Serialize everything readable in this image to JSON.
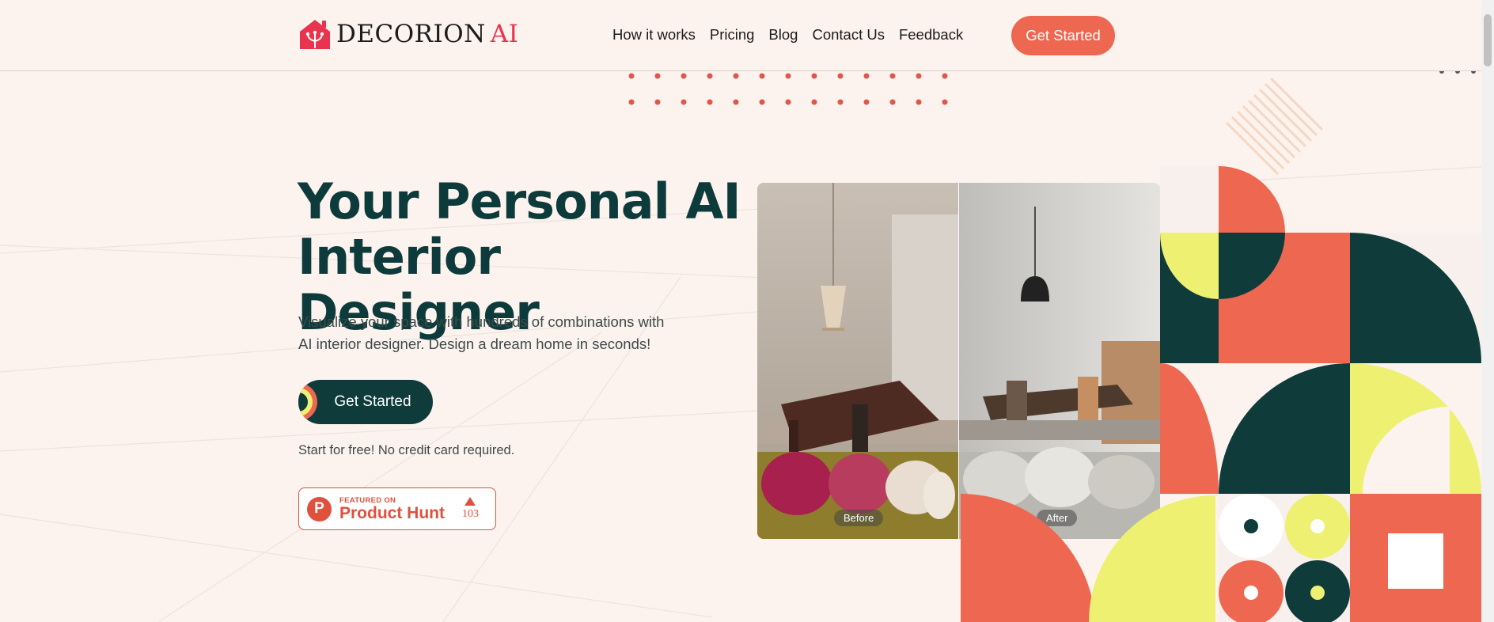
{
  "header": {
    "logo_text": "DECORION",
    "logo_ai": "AI",
    "nav": [
      "How it works",
      "Pricing",
      "Blog",
      "Contact Us",
      "Feedback"
    ],
    "cta": "Get Started"
  },
  "hero": {
    "title_line1": "Your Personal AI",
    "title_line2": "Interior Designer",
    "subtitle_line1": "Visualize your space with hundreds of combinations with",
    "subtitle_line2": "AI interior designer. Design a dream home in seconds!",
    "cta": "Get Started",
    "note": "Start for free! No credit card required."
  },
  "product_hunt": {
    "featured_on": "FEATURED ON",
    "name": "Product Hunt",
    "votes": "103",
    "logo_letter": "P"
  },
  "comparison": {
    "before_label": "Before",
    "after_label": "After"
  },
  "colors": {
    "primary": "#0f3b3b",
    "accent": "#ee6751",
    "yellow": "#eef071",
    "background": "#fcf3ee",
    "logo_red": "#e8344e"
  }
}
